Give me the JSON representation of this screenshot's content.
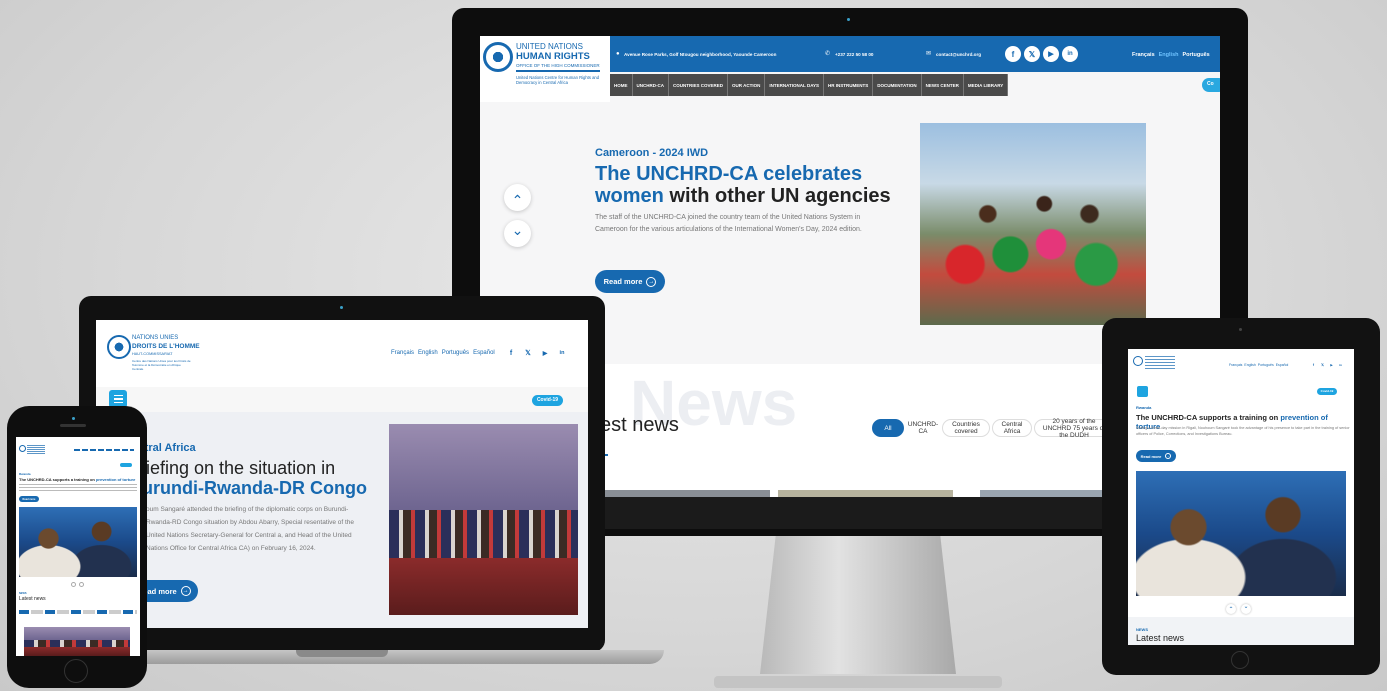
{
  "desktop": {
    "header": {
      "logo_line1": "UNITED NATIONS",
      "logo_line2": "HUMAN RIGHTS",
      "logo_line3": "OFFICE OF THE HIGH COMMISSIONER",
      "logo_sub": "United Nations Centre for Human Rights and Democracy in Central Africa",
      "address": "Avenue Rose Parks, Golf Ntougou neighborhood, Yaounde Cameroon",
      "phone": "+237 222 50 58 00",
      "email": "contact@unchrd.org",
      "languages": [
        "Français",
        "English",
        "Português"
      ],
      "covid_label": "Co"
    },
    "nav": [
      "HOME",
      "UNCHRD-CA",
      "COUNTRIES COVERED",
      "OUR ACTION",
      "INTERNATIONAL DAYS",
      "HR INSTRUMENTS",
      "DOCUMENTATION",
      "NEWS CENTER",
      "MEDIA LIBRARY"
    ],
    "hero": {
      "kicker": "Cameroon - 2024 IWD",
      "title_blue": "The UNCHRD-CA celebrates women",
      "title_dark": "with other UN agencies",
      "body": "The staff of the UNCHRD-CA joined the country team of the United Nations System in Cameroon for the various articulations of the International Women's Day, 2024 edition.",
      "read_more": "Read more"
    },
    "news": {
      "heading": "est news",
      "watermark": "News",
      "filters": [
        "All",
        "UNCHRD-CA",
        "Countries covered",
        "Central Africa",
        "20 years of the UNCHRD 75 years of the DUDH"
      ]
    }
  },
  "laptop": {
    "logo_line1": "NATIONS UNIES",
    "logo_line2": "DROITS DE L'HOMME",
    "logo_line3": "HAUT-COMMISSARIAT",
    "logo_sub": "Centre des Nations Unies pour les Droits de l'Homme et la Démocratie en Afrique Centrale",
    "languages": [
      "Français",
      "English",
      "Português",
      "Español"
    ],
    "covid_label": "Covid-19",
    "kicker": "ntral Africa",
    "title_line1": "riefing on the situation in",
    "title_line2": "urundi-Rwanda-DR Congo",
    "body": "oum Sangaré attended the briefing of the diplomatic corps on Burundi-Rwanda-RD Congo situation by Abdou Abarry, Special resentative of the United Nations Secretary-General for Central a, and Head of the United Nations Office for Central Africa CA) on February 16, 2024.",
    "read_more": "ead more"
  },
  "tablet": {
    "languages_line": "Français  English  Português  Español",
    "covid_label": "Covid-19",
    "kicker": "Rwanda",
    "title_dark": "The UNCHRD-CA supports a training on",
    "title_blue": "prevention of torture",
    "body": "During a three-day mission in Rigali, Nouhoum Sangaré took the advantage of his presence to take part in the training of senior officers of Police, Corrections, and Investigations Bureau.",
    "read_more": "Read more",
    "news_kicker": "NEWS",
    "news_heading": "Latest news"
  },
  "phone": {
    "kicker": "Rwanda",
    "title_dark": "The UNCHRD-CA supports a training on",
    "title_blue": "prevention of torture",
    "read_more": "Read more",
    "news_kicker": "NEWS",
    "news_heading": "Latest news"
  },
  "icons": {
    "facebook": "f",
    "x": "𝕏",
    "youtube": "▶",
    "linkedin": "in",
    "chevron_up": "⌃",
    "chevron_down": "⌄",
    "arrow_right": "→"
  }
}
